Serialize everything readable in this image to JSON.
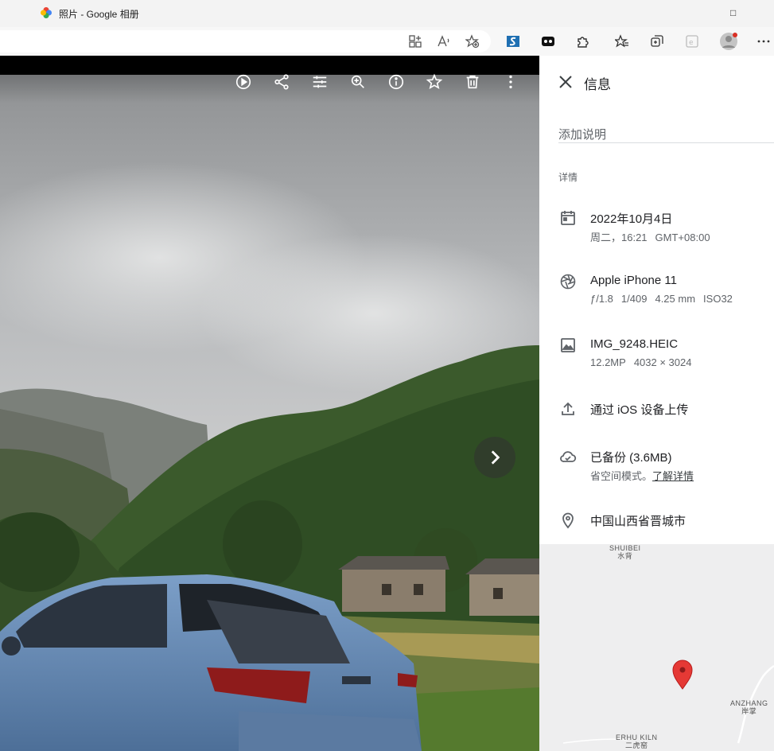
{
  "browser": {
    "tab_title": "照片 - Google 相册",
    "window_control_minimize": "□",
    "toolbar_icons": [
      "app-install-icon",
      "read-aloud-icon",
      "add-favorite-icon",
      "extension-s-icon",
      "extension-theater-icon",
      "extensions-icon",
      "favorites-icon",
      "collections-icon",
      "ie-mode-icon",
      "profile-icon",
      "more-icon"
    ]
  },
  "viewer": {
    "toolbar_icons": [
      "slideshow-icon",
      "share-icon",
      "edit-icon",
      "zoom-icon",
      "info-icon",
      "favorite-icon",
      "delete-icon",
      "more-options-icon"
    ],
    "next_icon": "chevron-right-icon"
  },
  "info_panel": {
    "title": "信息",
    "description_placeholder": "添加说明",
    "details_label": "详情",
    "date": {
      "main": "2022年10月4日",
      "weekday_time": "周二，16:21",
      "timezone": "GMT+08:00"
    },
    "camera": {
      "main": "Apple iPhone 11",
      "aperture": "ƒ/1.8",
      "shutter": "1/409",
      "focal": "4.25 mm",
      "iso": "ISO32"
    },
    "file": {
      "main": "IMG_9248.HEIC",
      "megapixels": "12.2MP",
      "resolution": "4032 × 3024"
    },
    "upload": {
      "main": "通过 iOS 设备上传"
    },
    "backup": {
      "main": "已备份 (3.6MB)",
      "mode": "省空间模式。",
      "link": "了解详情"
    },
    "location": {
      "main": "中国山西省晋城市"
    },
    "map": {
      "labels": [
        {
          "en": "SHUIBEI",
          "zh": "水背"
        },
        {
          "en": "ANZHANG",
          "zh": "岸掌"
        },
        {
          "en": "ERHU KILN",
          "zh": "二虎窑"
        }
      ],
      "pin_color": "#e53935"
    }
  }
}
